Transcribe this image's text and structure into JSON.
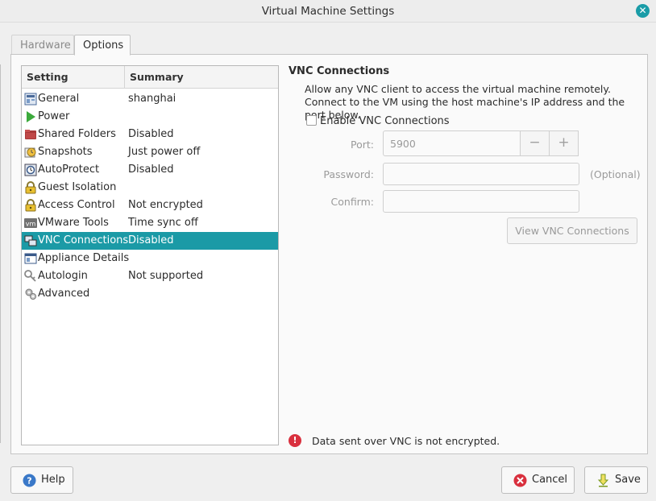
{
  "window": {
    "title": "Virtual Machine Settings"
  },
  "tabs": [
    {
      "label": "Hardware",
      "active": false
    },
    {
      "label": "Options",
      "active": true
    }
  ],
  "list": {
    "headers": {
      "setting": "Setting",
      "summary": "Summary"
    },
    "items": [
      {
        "label": "General",
        "summary": "shanghai",
        "icon": "general-icon"
      },
      {
        "label": "Power",
        "summary": "",
        "icon": "power-icon"
      },
      {
        "label": "Shared Folders",
        "summary": "Disabled",
        "icon": "shared-folders-icon"
      },
      {
        "label": "Snapshots",
        "summary": "Just power off",
        "icon": "snapshots-icon"
      },
      {
        "label": "AutoProtect",
        "summary": "Disabled",
        "icon": "autoprotect-icon"
      },
      {
        "label": "Guest Isolation",
        "summary": "",
        "icon": "lock-icon"
      },
      {
        "label": "Access Control",
        "summary": "Not encrypted",
        "icon": "lock-icon"
      },
      {
        "label": "VMware Tools",
        "summary": "Time sync off",
        "icon": "vmware-tools-icon"
      },
      {
        "label": "VNC Connections",
        "summary": "Disabled",
        "icon": "vnc-icon",
        "selected": true
      },
      {
        "label": "Appliance Details",
        "summary": "",
        "icon": "appliance-icon"
      },
      {
        "label": "Autologin",
        "summary": "Not supported",
        "icon": "key-icon"
      },
      {
        "label": "Advanced",
        "summary": "",
        "icon": "gears-icon"
      }
    ]
  },
  "vnc": {
    "title": "VNC Connections",
    "description": "Allow any VNC client to access the virtual machine remotely. Connect to the VM using the host machine's IP address and the port below.",
    "enable_label": "Enable VNC Connections",
    "port_label": "Port:",
    "port_value": "5900",
    "password_label": "Password:",
    "optional_label": "(Optional)",
    "confirm_label": "Confirm:",
    "view_button": "View VNC Connections",
    "warning": "Data sent over VNC is not encrypted."
  },
  "buttons": {
    "help": "Help",
    "cancel": "Cancel",
    "save": "Save"
  },
  "colors": {
    "accent": "#1b9aa6",
    "warning": "#d9303e"
  }
}
